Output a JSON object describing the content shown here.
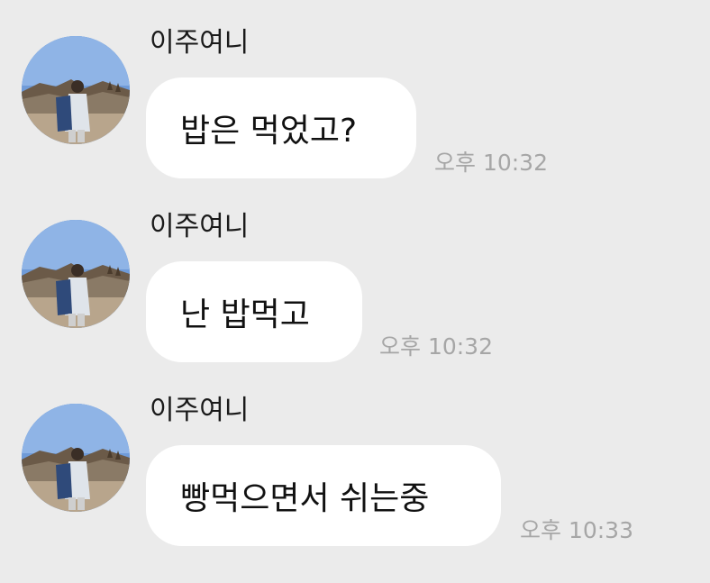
{
  "messages": [
    {
      "sender": "이주여니",
      "avatar": "profile-photo",
      "text": "밥은 먹었고?",
      "time": "오후 10:32"
    },
    {
      "sender": "이주여니",
      "avatar": "profile-photo",
      "text": "난 밥먹고",
      "time": "오후 10:32"
    },
    {
      "sender": "이주여니",
      "avatar": "profile-photo",
      "text": "빵먹으면서 쉬는중",
      "time": "오후 10:33"
    }
  ],
  "colors": {
    "background": "#ebebeb",
    "bubble": "#ffffff",
    "time_text": "#a6a6a6",
    "sender_text": "#1a1a1a"
  }
}
